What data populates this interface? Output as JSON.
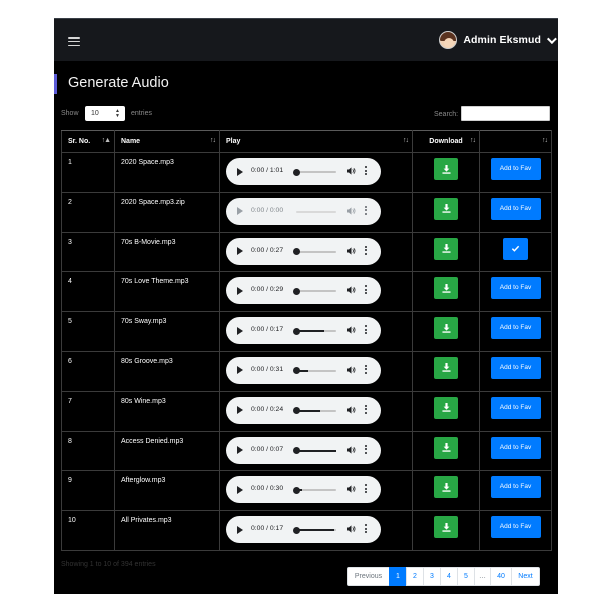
{
  "header": {
    "user_name": "Admin Eksmud"
  },
  "page": {
    "title": "Generate Audio"
  },
  "controls": {
    "show_label": "Show",
    "length_value": "10",
    "entries_label": "entries",
    "search_label": "Search:",
    "search_value": ""
  },
  "table": {
    "columns": [
      "Sr. No.",
      "Name",
      "Play",
      "Download",
      ""
    ],
    "fav_label": "Add to Fav",
    "rows": [
      {
        "sr": "1",
        "name": "2020 Space.mp3",
        "time": "0:00 / 1:01",
        "progress": 0.0,
        "enabled": true,
        "fav": false
      },
      {
        "sr": "2",
        "name": "2020 Space.mp3.zip",
        "time": "0:00 / 0:00",
        "progress": 0.0,
        "enabled": false,
        "fav": false
      },
      {
        "sr": "3",
        "name": "70s B-Movie.mp3",
        "time": "0:00 / 0:27",
        "progress": 0.0,
        "enabled": true,
        "fav": true
      },
      {
        "sr": "4",
        "name": "70s Love Theme.mp3",
        "time": "0:00 / 0:29",
        "progress": 0.0,
        "enabled": true,
        "fav": false
      },
      {
        "sr": "5",
        "name": "70s Sway.mp3",
        "time": "0:00 / 0:17",
        "progress": 0.0,
        "buffered": 0.7,
        "enabled": true,
        "fav": false
      },
      {
        "sr": "6",
        "name": "80s Groove.mp3",
        "time": "0:00 / 0:31",
        "progress": 0.0,
        "buffered": 0.3,
        "enabled": true,
        "fav": false
      },
      {
        "sr": "7",
        "name": "80s Wine.mp3",
        "time": "0:00 / 0:24",
        "progress": 0.0,
        "buffered": 0.6,
        "enabled": true,
        "fav": false
      },
      {
        "sr": "8",
        "name": "Access Denied.mp3",
        "time": "0:00 / 0:07",
        "progress": 0.0,
        "buffered": 1.0,
        "enabled": true,
        "fav": false
      },
      {
        "sr": "9",
        "name": "Afterglow.mp3",
        "time": "0:00 / 0:30",
        "progress": 0.0,
        "buffered": 0.15,
        "enabled": true,
        "fav": false
      },
      {
        "sr": "10",
        "name": "All Privates.mp3",
        "time": "0:00 / 0:17",
        "progress": 0.0,
        "buffered": 0.95,
        "enabled": true,
        "fav": false
      }
    ]
  },
  "footer": {
    "info": "Showing 1 to 10 of 394 entries",
    "previous": "Previous",
    "pages": [
      "1",
      "2",
      "3",
      "4",
      "5",
      "…",
      "40"
    ],
    "active_page": "1",
    "next": "Next"
  },
  "colors": {
    "accent": "#5b5bd6",
    "download": "#28a745",
    "fav": "#007bff"
  }
}
